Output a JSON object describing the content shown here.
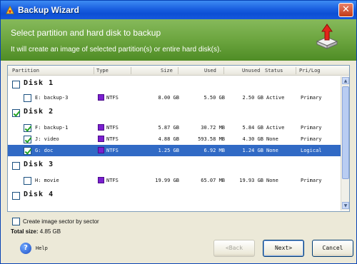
{
  "window": {
    "title": "Backup Wizard",
    "close_glyph": "✕"
  },
  "banner": {
    "heading": "Select partition and hard disk to backup",
    "subheading": "It will create an image of selected partition(s) or entire hard disk(s)."
  },
  "table": {
    "columns": [
      "Partition",
      "Type",
      "Size",
      "Used",
      "Unused",
      "Status",
      "Pri/Log"
    ],
    "disks": [
      {
        "label": "Disk 1",
        "checked": false,
        "partitions": [
          {
            "name": "E: backup-3",
            "type": "NTFS",
            "size": "8.00 GB",
            "used": "5.50 GB",
            "unused": "2.50 GB",
            "status": "Active",
            "pri_log": "Primary",
            "checked": false
          }
        ]
      },
      {
        "label": "Disk 2",
        "checked": true,
        "partitions": [
          {
            "name": "F: backup-1",
            "type": "NTFS",
            "size": "5.87 GB",
            "used": "30.72 MB",
            "unused": "5.84 GB",
            "status": "Active",
            "pri_log": "Primary",
            "checked": true
          },
          {
            "name": "J: video",
            "type": "NTFS",
            "size": "4.88 GB",
            "used": "593.58 MB",
            "unused": "4.30 GB",
            "status": "None",
            "pri_log": "Primary",
            "checked": true
          },
          {
            "name": "G: doc",
            "type": "NTFS",
            "size": "1.25 GB",
            "used": "6.92 MB",
            "unused": "1.24 GB",
            "status": "None",
            "pri_log": "Logical",
            "checked": true,
            "selected": true
          }
        ]
      },
      {
        "label": "Disk 3",
        "checked": false,
        "partitions": [
          {
            "name": "H: movie",
            "type": "NTFS",
            "size": "19.99 GB",
            "used": "65.07 MB",
            "unused": "19.93 GB",
            "status": "None",
            "pri_log": "Primary",
            "checked": false
          }
        ]
      },
      {
        "label": "Disk 4",
        "checked": false,
        "partitions": []
      }
    ]
  },
  "options": {
    "sector_by_sector_label": "Create image sector by sector",
    "sector_by_sector_checked": false
  },
  "total": {
    "label": "Total size:",
    "value": "4.85 GB"
  },
  "footer": {
    "help_label": "Help",
    "back_label": "<Back",
    "next_label": "Next>",
    "cancel_label": "Cancel"
  },
  "colors": {
    "fs_swatch": "#7a1fcf",
    "selection": "#316ac5",
    "banner": "#6ca53f",
    "titlebar": "#1a5fe0"
  },
  "icons": {
    "app": "wizard-icon",
    "banner": "hard-disk-upload-icon",
    "help": "question-icon"
  }
}
